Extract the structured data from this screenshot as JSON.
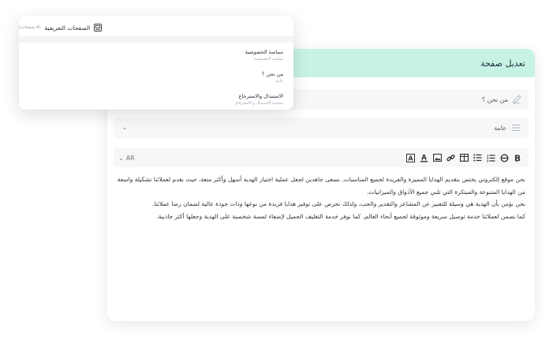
{
  "main": {
    "header_title": "تعديل صفحة",
    "title_value": "من نحن ؟",
    "type_value": "عامة",
    "editor": {
      "language": "AR",
      "tools": [
        "bold",
        "strikethrough",
        "ordered-list",
        "bullet-list",
        "table",
        "link",
        "image",
        "text-color",
        "highlight"
      ],
      "paragraphs": [
        "نحن موقع إلكتروني يختص بتقديم الهدايا المميزة والفريدة لجميع المناسبات. نسعى جاهدين لجعل عملية اختيار الهدية أسهل وأكثر متعة، حيث نقدم لعملائنا تشكيلة واسعة من الهدايا المتنوعة والمبتكرة التي تلبي جميع الأذواق والميزانيات.",
        "نحن نؤمن بأن الهدية هي وسيلة للتعبير عن المشاعر والتقدير والحب، ولذلك نحرص على توفير هدايا فريدة من نوعها وذات جودة عالية لضمان رضا عملائنا.",
        "كما نضمن لعملائنا خدمة توصيل سريعة وموثوقة لجميع أنحاء العالم، كما نوفر خدمة التغليف الجميل لإضفاء لمسة شخصية على الهدية وجعلها أكثر جاذبية."
      ]
    }
  },
  "dropdown": {
    "title": "الصفحات التعريفية",
    "count": "(4 صفحات)",
    "items": [
      {
        "title": "سياسة الخصوصية",
        "subtitle": "سياسة الخصوصية"
      },
      {
        "title": "من نحن ؟",
        "subtitle": "عامة"
      },
      {
        "title": "الاستبدال والاسترجاع",
        "subtitle": "سياسة الاستبدال و الاسترجاع"
      }
    ]
  },
  "colors": {
    "header_bg": "#c7f3e5",
    "field_bg": "#f6f7f9"
  }
}
